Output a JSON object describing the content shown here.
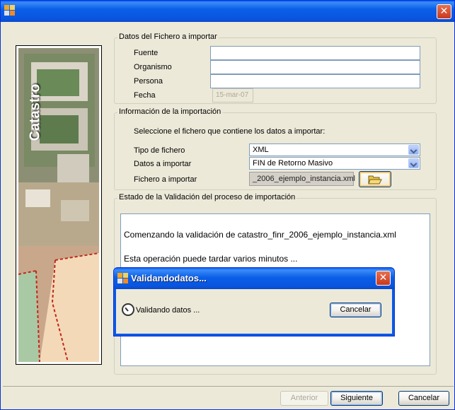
{
  "window": {
    "title": ""
  },
  "image_panel": {
    "brand": "Catastro"
  },
  "file_data": {
    "legend": "Datos del Fichero a importar",
    "fuente_label": "Fuente",
    "fuente_value": "",
    "organismo_label": "Organismo",
    "organismo_value": "",
    "persona_label": "Persona",
    "persona_value": "",
    "fecha_label": "Fecha",
    "fecha_value": "15-mar-07"
  },
  "import_info": {
    "legend": "Información de la importación",
    "instruction": "Seleccione el fichero que contiene los datos a importar:",
    "tipo_label": "Tipo de fichero",
    "tipo_value": "XML",
    "datos_label": "Datos a importar",
    "datos_value": "FIN de Retorno Masivo",
    "fichero_label": "Fichero a importar",
    "fichero_value": "_2006_ejemplo_instancia.xml"
  },
  "validation": {
    "legend": "Estado de la Validación del proceso de importación",
    "log": [
      "Comenzando la validación de catastro_finr_2006_ejemplo_instancia.xml",
      "Esta operación puede tardar varios minutos ..."
    ]
  },
  "dialog": {
    "title": "Validandodatos...",
    "message": "Validando datos ...",
    "cancel_label": "Cancelar"
  },
  "footer": {
    "prev_label": "Anterior",
    "next_label": "Siguiente",
    "cancel_label": "Cancelar"
  }
}
